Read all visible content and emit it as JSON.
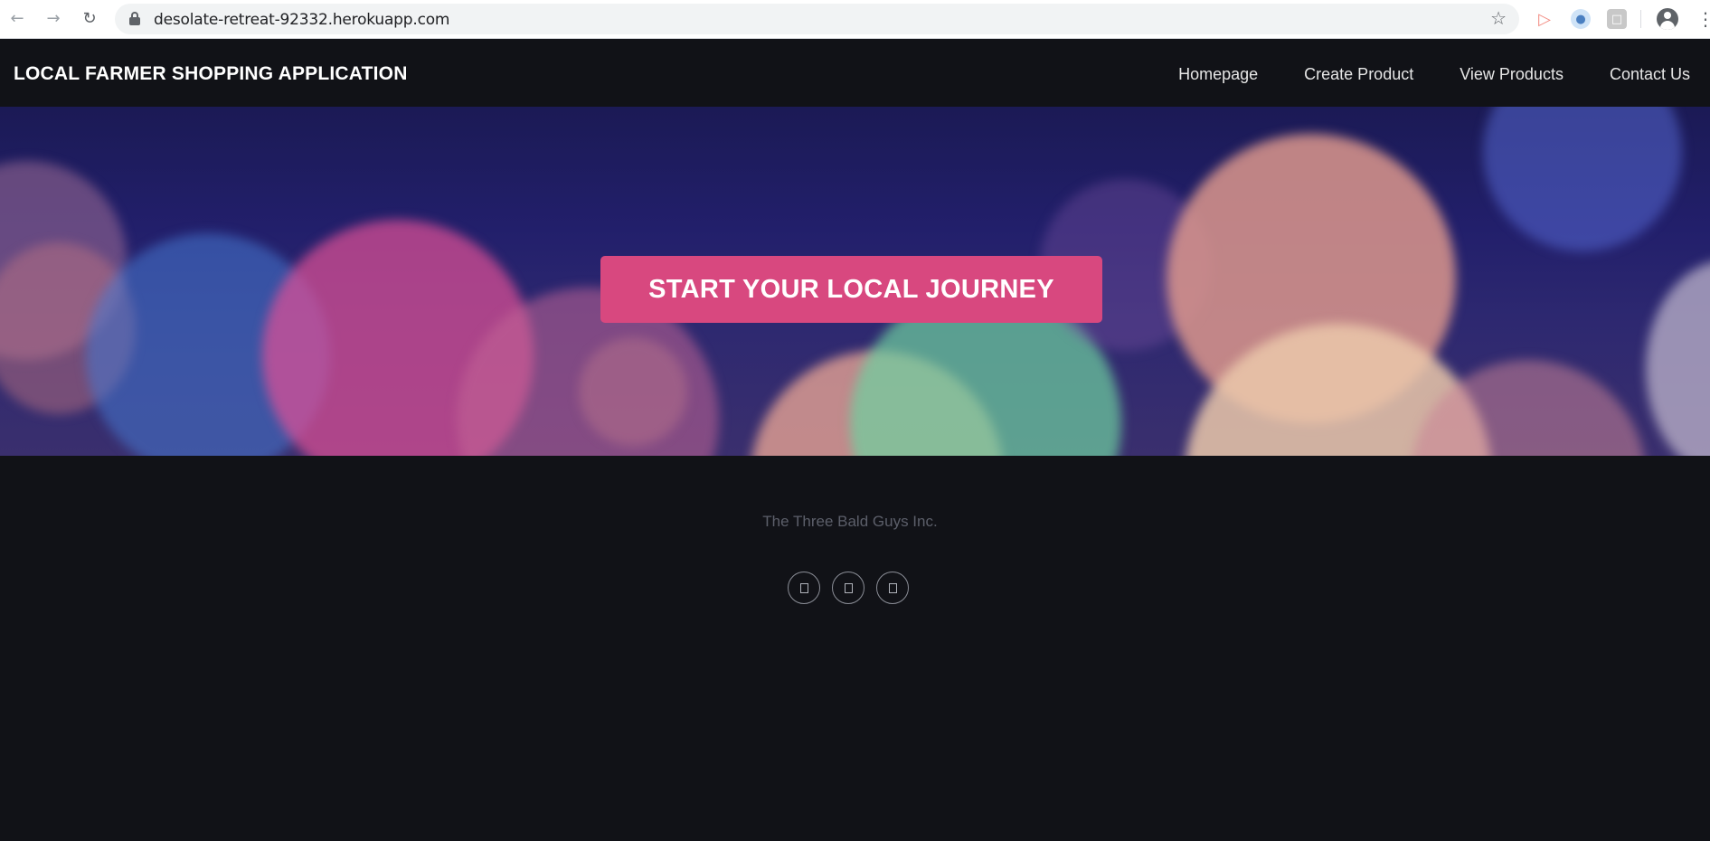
{
  "browser": {
    "url": "desolate-retreat-92332.herokuapp.com",
    "icons": [
      "back-icon",
      "forward-icon",
      "reload-icon",
      "lock-icon",
      "star-icon",
      "extension-icon",
      "extension-icon",
      "extension-icon",
      "profile-icon",
      "menu-icon"
    ]
  },
  "navbar": {
    "brand": "LOCAL FARMER SHOPPING APPLICATION",
    "links": [
      "Homepage",
      "Create Product",
      "View Products",
      "Contact Us"
    ]
  },
  "hero": {
    "cta_label": "START YOUR LOCAL JOURNEY",
    "cta_color": "#d8487f"
  },
  "footer": {
    "company": "The Three Bald Guys Inc.",
    "social_icons": [
      "social-icon",
      "social-icon",
      "social-icon"
    ]
  },
  "colors": {
    "page_bg": "#111217",
    "text": "#ffffff",
    "muted": "#5c5f6a"
  }
}
